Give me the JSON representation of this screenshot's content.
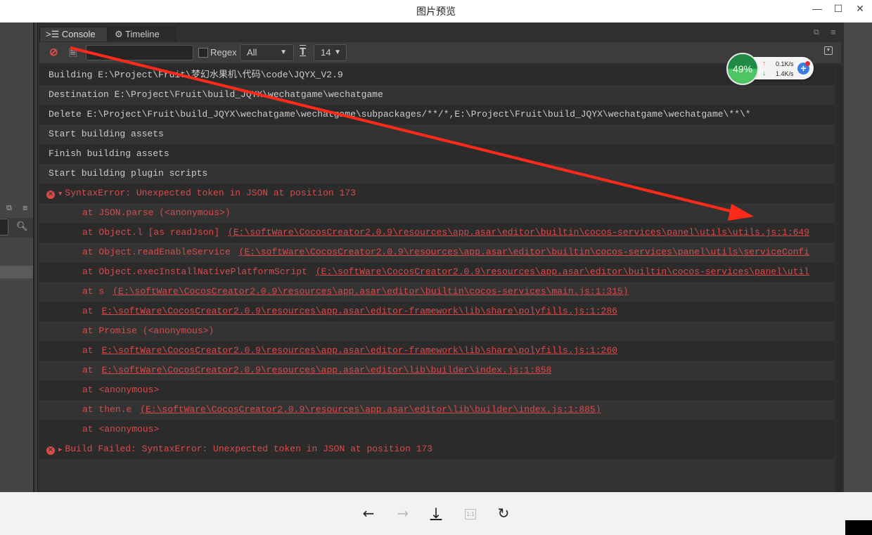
{
  "window": {
    "title": "图片预览"
  },
  "console": {
    "tabs": [
      {
        "label": "Console",
        "icon": "console-icon"
      },
      {
        "label": "Timeline",
        "icon": "timeline-icon"
      }
    ],
    "toolbar": {
      "filter_value": "",
      "regex_label": "Regex",
      "level_select": "All",
      "font_size_select": "14"
    },
    "logs": [
      "Building E:\\Project\\Fruit\\梦幻水果机\\代码\\code\\JQYX_V2.9",
      "Destination E:\\Project\\Fruit\\build_JQYX\\wechatgame\\wechatgame",
      "Delete E:\\Project\\Fruit\\build_JQYX\\wechatgame\\wechatgame\\subpackages/**/*,E:\\Project\\Fruit\\build_JQYX\\wechatgame\\wechatgame\\**\\*",
      "Start building assets",
      "Finish building assets",
      "Start building plugin scripts"
    ],
    "error": {
      "message": "SyntaxError: Unexpected token  in JSON at position 173",
      "stack": [
        {
          "text": "at JSON.parse (<anonymous>)",
          "link": ""
        },
        {
          "text": "at Object.l [as readJson]",
          "link": "(E:\\softWare\\CocosCreator2.0.9\\resources\\app.asar\\editor\\builtin\\cocos-services\\panel\\utils\\utils.js:1:649"
        },
        {
          "text": "at Object.readEnableService",
          "link": "(E:\\softWare\\CocosCreator2.0.9\\resources\\app.asar\\editor\\builtin\\cocos-services\\panel\\utils\\serviceConfi"
        },
        {
          "text": "at Object.execInstallNativePlatformScript",
          "link": "(E:\\softWare\\CocosCreator2.0.9\\resources\\app.asar\\editor\\builtin\\cocos-services\\panel\\util"
        },
        {
          "text": "at s",
          "link": "(E:\\softWare\\CocosCreator2.0.9\\resources\\app.asar\\editor\\builtin\\cocos-services\\main.js:1:315)"
        },
        {
          "text": "at",
          "link": "E:\\softWare\\CocosCreator2.0.9\\resources\\app.asar\\editor-framework\\lib\\share\\polyfills.js:1:286"
        },
        {
          "text": "at Promise (<anonymous>)",
          "link": ""
        },
        {
          "text": "at",
          "link": "E:\\softWare\\CocosCreator2.0.9\\resources\\app.asar\\editor-framework\\lib\\share\\polyfills.js:1:260"
        },
        {
          "text": "at",
          "link": "E:\\softWare\\CocosCreator2.0.9\\resources\\app.asar\\editor\\lib\\builder\\index.js:1:858"
        },
        {
          "text": "at <anonymous>",
          "link": ""
        },
        {
          "text": "at then.e",
          "link": "(E:\\softWare\\CocosCreator2.0.9\\resources\\app.asar\\editor\\lib\\builder\\index.js:1:885)"
        },
        {
          "text": "at <anonymous>",
          "link": ""
        }
      ],
      "final": "Build Failed: SyntaxError: Unexpected token  in JSON at position 173"
    },
    "error_color": "#d94b4b"
  },
  "net_widget": {
    "percent": "49%",
    "upload": "0.1K/s",
    "download": "1.4K/s"
  },
  "annotation_color": "#ff2a1a"
}
